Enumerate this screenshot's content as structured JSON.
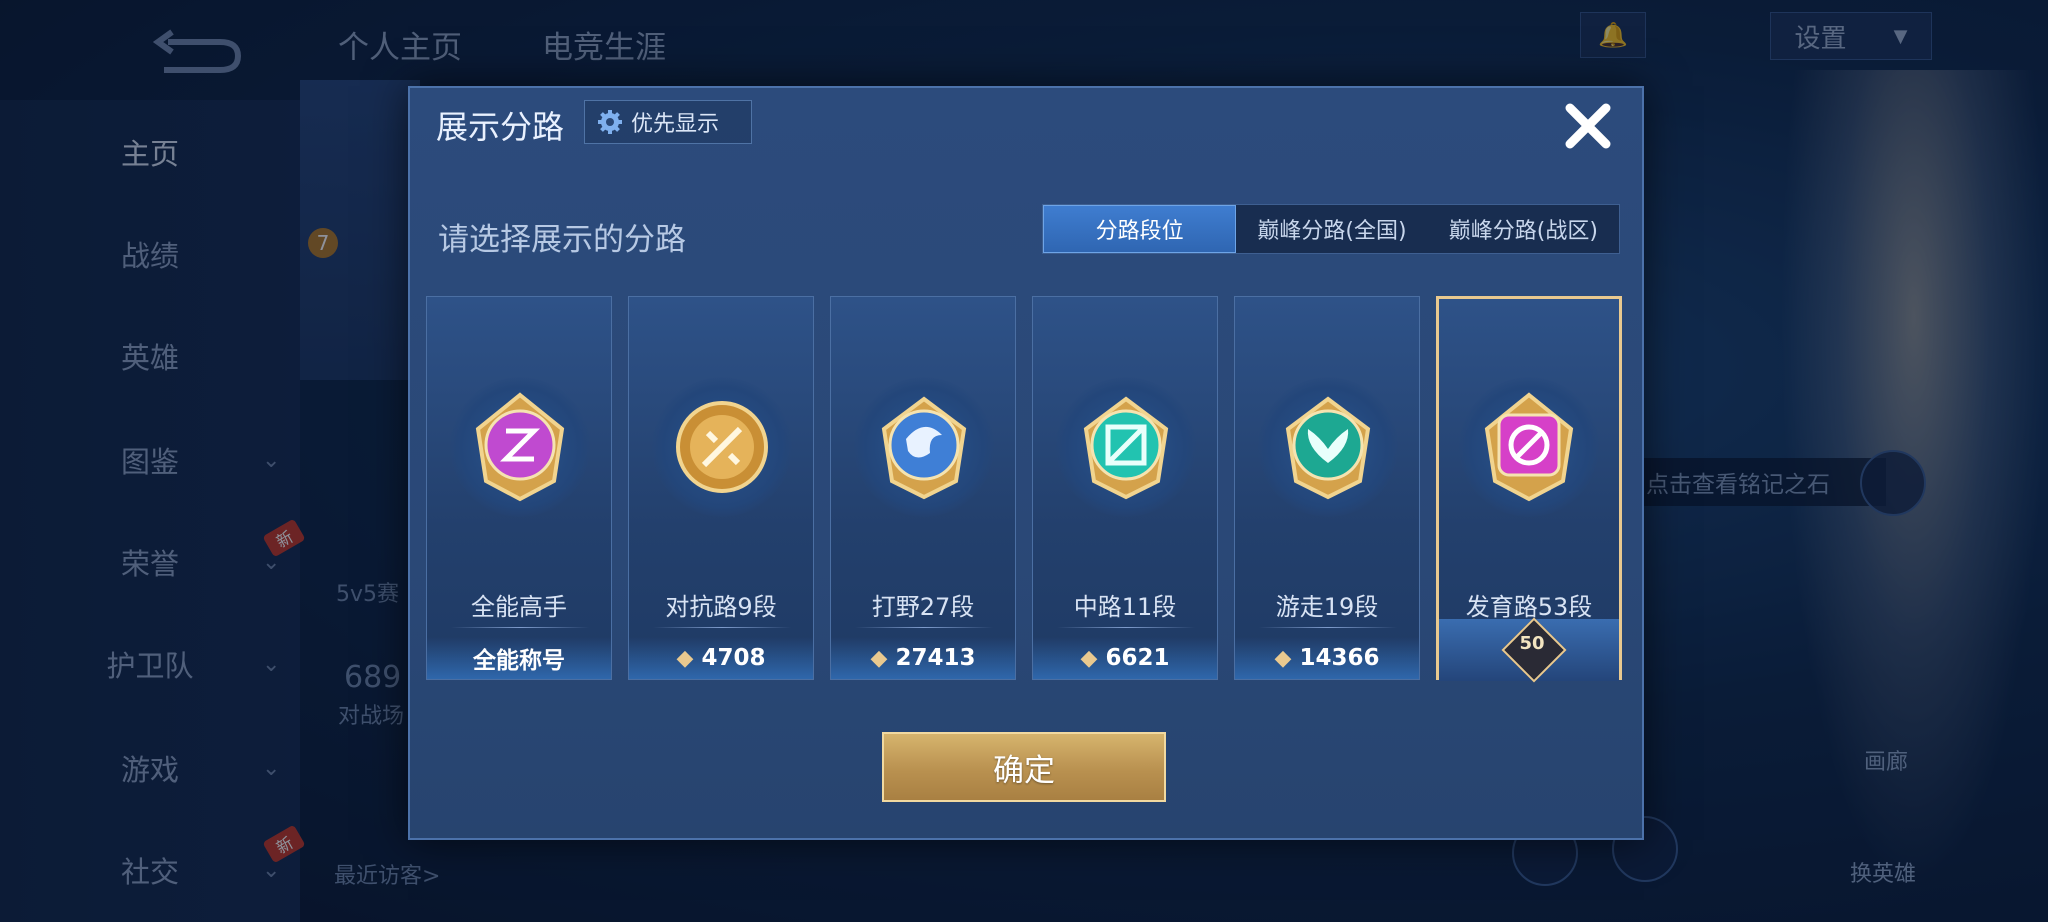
{
  "background": {
    "top_tabs": [
      "个人主页",
      "电竞生涯"
    ],
    "sidebar": [
      {
        "label": "主页",
        "chevron": false,
        "new": false
      },
      {
        "label": "战绩",
        "chevron": false,
        "new": false
      },
      {
        "label": "英雄",
        "chevron": false,
        "new": false
      },
      {
        "label": "图鉴",
        "chevron": true,
        "new": false
      },
      {
        "label": "荣誉",
        "chevron": true,
        "new": true
      },
      {
        "label": "护卫队",
        "chevron": true,
        "new": false
      },
      {
        "label": "游戏",
        "chevron": true,
        "new": false
      },
      {
        "label": "社交",
        "chevron": true,
        "new": true
      }
    ],
    "new_badge": "新",
    "settings_label": "设置",
    "mode_text": "5v5赛",
    "score_text": "689",
    "score_sub": "对战场",
    "recent_visitors": "最近访客>",
    "tip_banner": "点击查看铭记之石",
    "right_buttons": [
      "画廊",
      "换英雄"
    ],
    "level_badge": "7"
  },
  "dialog": {
    "title": "展示分路",
    "priority_label": "优先显示",
    "subtitle": "请选择展示的分路",
    "segments": [
      {
        "label": "分路段位",
        "active": true
      },
      {
        "label": "巅峰分路(全国)",
        "active": false
      },
      {
        "label": "巅峰分路(战区)",
        "active": false
      }
    ],
    "cards": [
      {
        "label": "全能高手",
        "footer": "全能称号",
        "points": null,
        "color": "#c04ad0",
        "selected": false
      },
      {
        "label": "对抗路9段",
        "footer": null,
        "points": "4708",
        "color": "#d9a64a",
        "selected": false
      },
      {
        "label": "打野27段",
        "footer": null,
        "points": "27413",
        "color": "#3f7fd6",
        "selected": false
      },
      {
        "label": "中路11段",
        "footer": null,
        "points": "6621",
        "color": "#22c3b0",
        "selected": false
      },
      {
        "label": "游走19段",
        "footer": null,
        "points": "14366",
        "color": "#1da892",
        "selected": false
      },
      {
        "label": "发育路53段",
        "footer": null,
        "points": null,
        "level": "50",
        "color": "#d640c8",
        "selected": true
      }
    ],
    "confirm_label": "确定"
  }
}
